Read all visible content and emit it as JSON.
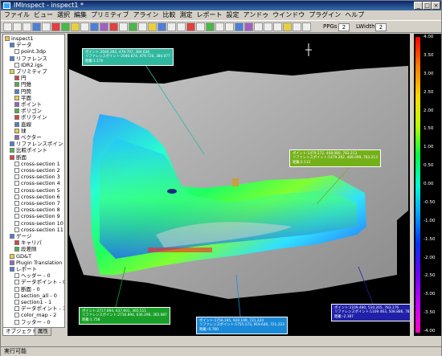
{
  "window": {
    "title": "IMInspect - inspect1 *"
  },
  "menu": [
    "ファイル",
    "ビュー",
    "選択",
    "編集",
    "プリミティブ",
    "アライン",
    "比較",
    "測定",
    "レポート",
    "設定",
    "アンドゥ",
    "ウインドウ",
    "プラグイン",
    "ヘルプ"
  ],
  "toolbar": {
    "ppgs_label": "PPGs",
    "ppgs_value": "2",
    "lwidth_label": "LWidth",
    "lwidth_value": "2"
  },
  "tree": {
    "items": [
      {
        "label": "inspect1",
        "indent": 1,
        "color": "#f0c040"
      },
      {
        "label": "データ",
        "indent": 2,
        "color": "#4d7fd6"
      },
      {
        "label": "point.3dp",
        "indent": 3,
        "color": "#ffffff"
      },
      {
        "label": "リファレンス",
        "indent": 2,
        "color": "#4d7fd6"
      },
      {
        "label": "IDR2.igs",
        "indent": 3,
        "color": "#ffffff"
      },
      {
        "label": "プリミティブ",
        "indent": 2,
        "color": "#e8d040"
      },
      {
        "label": "円",
        "indent": 3,
        "color": "#e04040"
      },
      {
        "label": "円錐",
        "indent": 3,
        "color": "#48b848"
      },
      {
        "label": "円筒",
        "indent": 3,
        "color": "#4d7fd6"
      },
      {
        "label": "平面",
        "indent": 3,
        "color": "#e8d040"
      },
      {
        "label": "ポイント",
        "indent": 3,
        "color": "#a060c0"
      },
      {
        "label": "ポリゴン",
        "indent": 3,
        "color": "#48b848"
      },
      {
        "label": "ポリライン",
        "indent": 3,
        "color": "#e04040"
      },
      {
        "label": "直線",
        "indent": 3,
        "color": "#4d7fd6"
      },
      {
        "label": "球",
        "indent": 3,
        "color": "#e8d040"
      },
      {
        "label": "ベクター",
        "indent": 3,
        "color": "#a060c0"
      },
      {
        "label": "リファレンスポイント",
        "indent": 2,
        "color": "#4d7fd6"
      },
      {
        "label": "比較ポイント",
        "indent": 2,
        "color": "#48b848"
      },
      {
        "label": "断面",
        "indent": 2,
        "color": "#e04040"
      },
      {
        "label": "cross-section 1",
        "indent": 3,
        "color": "#ffffff"
      },
      {
        "label": "cross-section 2",
        "indent": 3,
        "color": "#ffffff"
      },
      {
        "label": "cross-section 3",
        "indent": 3,
        "color": "#ffffff"
      },
      {
        "label": "cross-section 4",
        "indent": 3,
        "color": "#ffffff"
      },
      {
        "label": "cross-section 5",
        "indent": 3,
        "color": "#ffffff"
      },
      {
        "label": "cross-section 6",
        "indent": 3,
        "color": "#ffffff"
      },
      {
        "label": "cross-section 7",
        "indent": 3,
        "color": "#ffffff"
      },
      {
        "label": "cross-section 8",
        "indent": 3,
        "color": "#ffffff"
      },
      {
        "label": "cross-section 9",
        "indent": 3,
        "color": "#ffffff"
      },
      {
        "label": "cross-section 10",
        "indent": 3,
        "color": "#ffffff"
      },
      {
        "label": "cross-section 11",
        "indent": 3,
        "color": "#ffffff"
      },
      {
        "label": "ゲージ",
        "indent": 2,
        "color": "#4d7fd6"
      },
      {
        "label": "キャリパ",
        "indent": 3,
        "color": "#e04040"
      },
      {
        "label": "段差隙",
        "indent": 3,
        "color": "#48b848"
      },
      {
        "label": "GD&T",
        "indent": 2,
        "color": "#e8d040"
      },
      {
        "label": "Plugin Translation",
        "indent": 2,
        "color": "#a060c0"
      },
      {
        "label": "レポート",
        "indent": 2,
        "color": "#4d7fd6"
      },
      {
        "label": "ヘッダー - 0",
        "indent": 3,
        "color": "#ffffff"
      },
      {
        "label": "データポイント - 0",
        "indent": 3,
        "color": "#ffffff"
      },
      {
        "label": "断面 - 0",
        "indent": 3,
        "color": "#ffffff"
      },
      {
        "label": "section_all - 0",
        "indent": 3,
        "color": "#ffffff"
      },
      {
        "label": "section1 - 1",
        "indent": 3,
        "color": "#ffffff"
      },
      {
        "label": "データポイント - 1",
        "indent": 3,
        "color": "#ffffff"
      },
      {
        "label": "color_map - 2",
        "indent": 3,
        "color": "#ffffff"
      },
      {
        "label": "フッター - 0",
        "indent": 3,
        "color": "#ffffff"
      }
    ],
    "tabs": [
      "オブジェクト",
      "属性"
    ]
  },
  "colorbar": {
    "labels": [
      "4.00",
      "3.50",
      "3.00",
      "2.50",
      "2.00",
      "1.50",
      "1.00",
      "0.50",
      "0.00",
      "-0.50",
      "-1.00",
      "-1.50",
      "-2.00",
      "-2.50",
      "-3.00",
      "-3.50",
      "-4.00"
    ]
  },
  "callouts": [
    {
      "lines": [
        "ポイント:2046.283, 479.797, 384.636",
        "リファレンスポイント:2046.874, 479.720, 384.077",
        "距離:1.170"
      ],
      "color": "#2fb8a0"
    },
    {
      "lines": [
        "ポイント:1479.272, 408.080, 783.213",
        "リファレンスポイント:1479.282, 408.099, 783.213",
        "距離:2.112"
      ],
      "color": "#74b018"
    },
    {
      "lines": [
        "ポイント:2717.894, 637.601, 365.511",
        "リファレンスポイント:2716.894, 636.296, 365.987",
        "距離:1.758"
      ],
      "color": "#1aa02a"
    },
    {
      "lines": [
        "ポイント:1756.195, 920.199, 721.224",
        "リファレンスポイント:1755.173, 919.640, 721.223",
        "距離:-0.760"
      ],
      "color": "#1a8ad8"
    },
    {
      "lines": [
        "ポイント:1109.480, 510.265, 783.176",
        "リファレンスポイント:1109.463, 508.886, 783.176",
        "距離:-2.187"
      ],
      "color": "#2020a8"
    }
  ],
  "status": {
    "text": "実行可能"
  }
}
